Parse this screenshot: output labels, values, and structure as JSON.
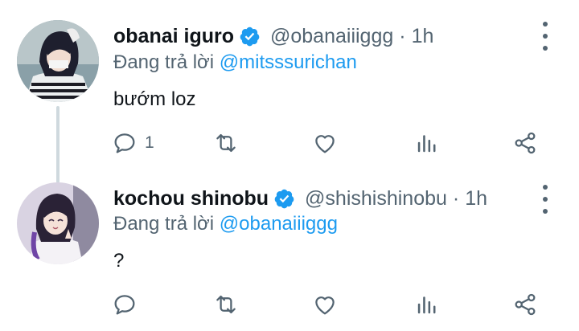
{
  "colors": {
    "accent": "#1d9bf0",
    "secondary_text": "#536471",
    "primary_text": "#0f1419"
  },
  "tweets": [
    {
      "author": {
        "name": "obanai iguro",
        "handle": "@obanaiiiggg",
        "verified": true
      },
      "time": "1h",
      "dot": "·",
      "reply_prefix": "Đang trả lời ",
      "reply_to": "@mitsssurichan",
      "text": "bướm loz",
      "actions": {
        "reply_count": "1"
      },
      "icons": [
        "reply-icon",
        "retweet-icon",
        "like-icon",
        "views-icon",
        "share-icon",
        "more-icon"
      ]
    },
    {
      "author": {
        "name": "kochou shinobu",
        "handle": "@shishishinobu",
        "verified": true
      },
      "time": "1h",
      "dot": "·",
      "reply_prefix": "Đang trả lời ",
      "reply_to": "@obanaiiiggg",
      "text": "?",
      "actions": {
        "reply_count": ""
      },
      "icons": [
        "reply-icon",
        "retweet-icon",
        "like-icon",
        "views-icon",
        "share-icon",
        "more-icon"
      ]
    }
  ]
}
